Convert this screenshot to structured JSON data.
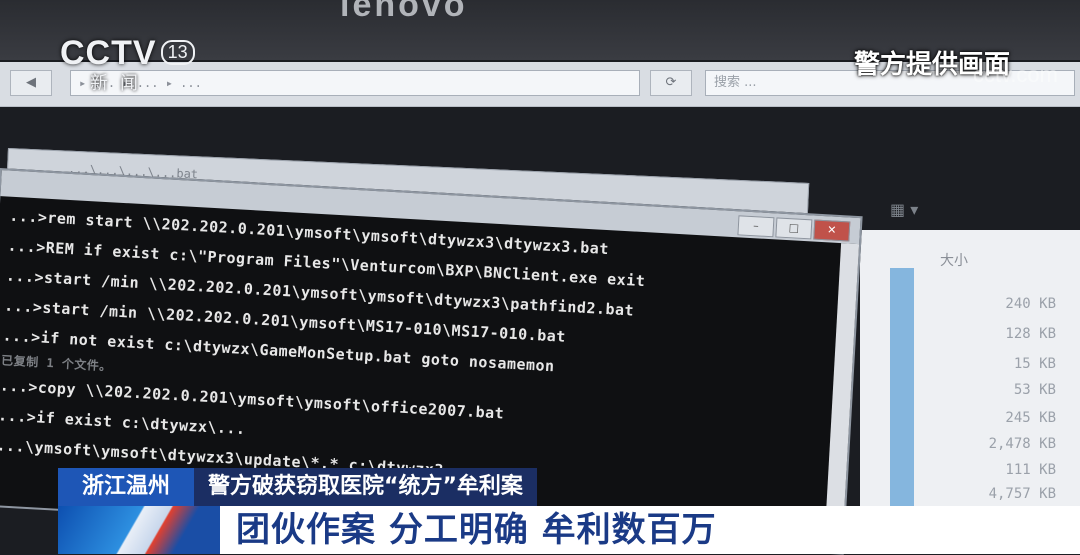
{
  "monitor": {
    "brand": "lenovo"
  },
  "broadcast": {
    "channel": "CCTV",
    "channel_number": "13",
    "channel_sub": "新闻",
    "source_tag": "警方提供画面",
    "watermark": "cctv.com"
  },
  "explorer": {
    "address_text": "▸ ... ▸ ... ▸ ...",
    "search_placeholder": "搜索 ...",
    "size_header": "大小",
    "sizes": [
      "240 KB",
      "128 KB",
      "15 KB",
      "53 KB",
      "245 KB",
      "2,478 KB",
      "111 KB",
      "4,757 KB"
    ]
  },
  "console": {
    "back_window_title": "...\\...\\...\\...bat",
    "lines": [
      "...>rem start \\\\202.202.0.201\\ymsoft\\ymsoft\\dtywzx3\\dtywzx3.bat",
      "...>REM if exist c:\\\"Program Files\"\\Venturcom\\BXP\\BNClient.exe exit",
      "...>start /min \\\\202.202.0.201\\ymsoft\\ymsoft\\dtywzx3\\pathfind2.bat",
      "...>start /min \\\\202.202.0.201\\ymsoft\\MS17-010\\MS17-010.bat",
      "...>if not exist c:\\dtywzx\\GameMonSetup.bat goto nosamemon",
      "...>copy \\\\202.202.0.201\\ymsoft\\ymsoft\\office2007.bat",
      "...>if exist c:\\dtywzx\\...",
      "...\\ymsoft\\ymsoft\\dtywzx3\\update\\*.* c:\\dtywzx3"
    ],
    "dim_lines": [
      "已复制  1 个文件。"
    ]
  },
  "lower_third": {
    "location": "浙江温州",
    "headline": "警方破获窃取医院“统方”牟利案",
    "tagline": "团伙作案 分工明确 牟利数百万"
  }
}
